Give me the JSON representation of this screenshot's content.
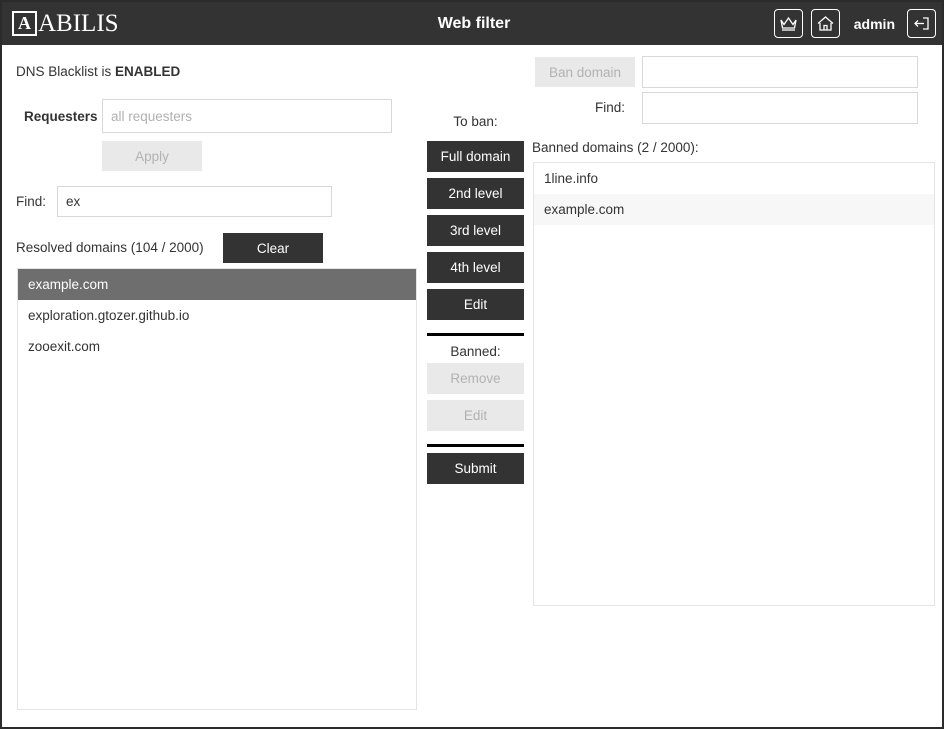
{
  "header": {
    "logo_mark": "A",
    "logo_text": "ABILIS",
    "title": "Web filter",
    "user": "admin",
    "icons": {
      "crown": "crown-icon",
      "home": "home-icon",
      "logout": "logout-icon"
    }
  },
  "left": {
    "status_prefix": "DNS Blacklist is ",
    "status_value": "ENABLED",
    "requesters_label": "Requesters",
    "requesters_value": "",
    "requesters_placeholder": "all requesters",
    "apply_label": "Apply",
    "apply_disabled": true,
    "find_label": "Find:",
    "find_value": "ex",
    "resolved_label": "Resolved domains (104 / 2000)",
    "clear_label": "Clear",
    "resolved_domains": [
      "example.com",
      "exploration.gtozer.github.io",
      "zooexit.com"
    ],
    "selected_domain": "example.com"
  },
  "center": {
    "to_ban_label": "To ban:",
    "to_ban_buttons": [
      "Full domain",
      "2nd level",
      "3rd level",
      "4th level",
      "Edit"
    ],
    "banned_label": "Banned:",
    "banned_buttons": [
      "Remove",
      "Edit"
    ],
    "submit_label": "Submit"
  },
  "right": {
    "ban_domain_label": "Ban domain",
    "ban_domain_disabled": true,
    "ban_input_value": "",
    "find_label": "Find:",
    "find_value": "",
    "banned_count_label": "Banned domains (2 / 2000):",
    "banned_domains": [
      "1line.info",
      "example.com"
    ]
  },
  "colors": {
    "header_bg": "#333333",
    "button_dark": "#333333",
    "selection": "#6e6e6e",
    "disabled_bg": "#e9e9e9",
    "disabled_text": "#b2b2b2",
    "alt_row": "#f7f7f7",
    "border": "#e4e4e4"
  }
}
